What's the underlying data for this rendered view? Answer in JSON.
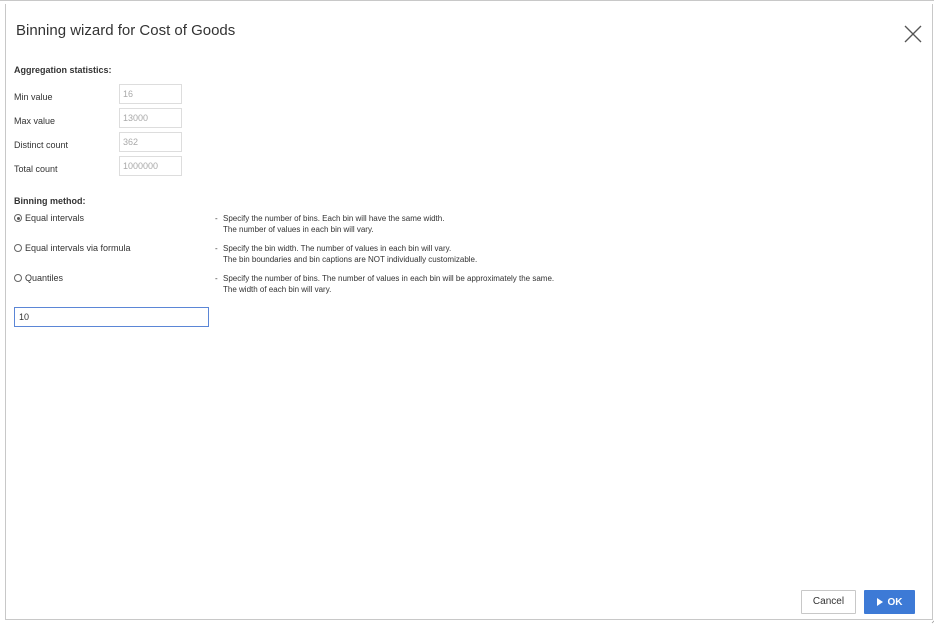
{
  "dialog": {
    "title": "Binning wizard for Cost of Goods",
    "close_icon": "close-icon"
  },
  "aggregation": {
    "heading": "Aggregation statistics:",
    "rows": [
      {
        "label": "Min value",
        "value": "16"
      },
      {
        "label": "Max value",
        "value": "13000"
      },
      {
        "label": "Distinct count",
        "value": "362"
      },
      {
        "label": "Total count",
        "value": "1000000"
      }
    ]
  },
  "binning": {
    "heading": "Binning method:",
    "options": [
      {
        "label": "Equal intervals",
        "selected": true,
        "desc_dash": "-",
        "desc": [
          "Specify the number of bins. Each bin will have the same width.",
          "The number of values in each bin will vary."
        ]
      },
      {
        "label": "Equal intervals via formula",
        "selected": false,
        "desc_dash": "-",
        "desc": [
          "Specify the bin width. The number of values in each bin will vary.",
          "The bin boundaries and bin captions are NOT individually customizable."
        ]
      },
      {
        "label": "Quantiles",
        "selected": false,
        "desc_dash": "-",
        "desc": [
          "Specify the number of bins. The number of values in each bin will be approximately the same.",
          "The width of each bin will vary."
        ]
      }
    ],
    "bins_value": "10"
  },
  "footer": {
    "cancel_label": "Cancel",
    "ok_label": "OK",
    "ok_icon": "play-icon"
  },
  "colors": {
    "accent": "#3d7ad6",
    "input_focus_border": "#5b86d6",
    "readonly_text": "#a9a9a9"
  }
}
